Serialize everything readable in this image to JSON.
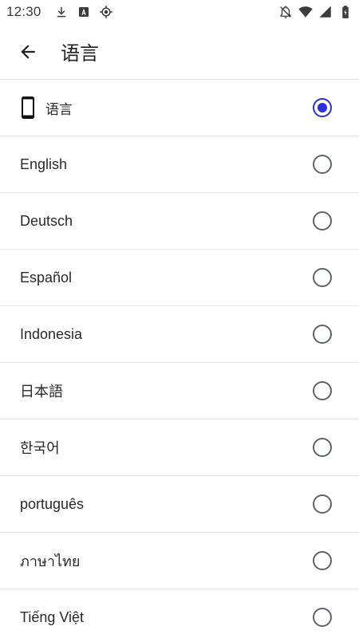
{
  "status_bar": {
    "time": "12:30",
    "icons_left": [
      "download-icon",
      "font-icon",
      "location-target-icon"
    ],
    "icons_right": [
      "notifications-off-icon",
      "wifi-icon",
      "signal-icon",
      "battery-icon"
    ]
  },
  "app_bar": {
    "back_icon": "arrow-back-icon",
    "title": "语言"
  },
  "languages": [
    {
      "label": "语言",
      "icon": "phone-icon",
      "selected": true
    },
    {
      "label": "English",
      "selected": false
    },
    {
      "label": "Deutsch",
      "selected": false
    },
    {
      "label": "Español",
      "selected": false
    },
    {
      "label": "Indonesia",
      "selected": false
    },
    {
      "label": "日本語",
      "selected": false
    },
    {
      "label": "한국어",
      "selected": false
    },
    {
      "label": "português",
      "selected": false
    },
    {
      "label": "ภาษาไทย",
      "selected": false
    },
    {
      "label": "Tiếng Việt",
      "selected": false
    }
  ],
  "colors": {
    "accent": "#2b2ee0",
    "radio_off": "#5f6368",
    "divider": "#e6e6e6"
  }
}
